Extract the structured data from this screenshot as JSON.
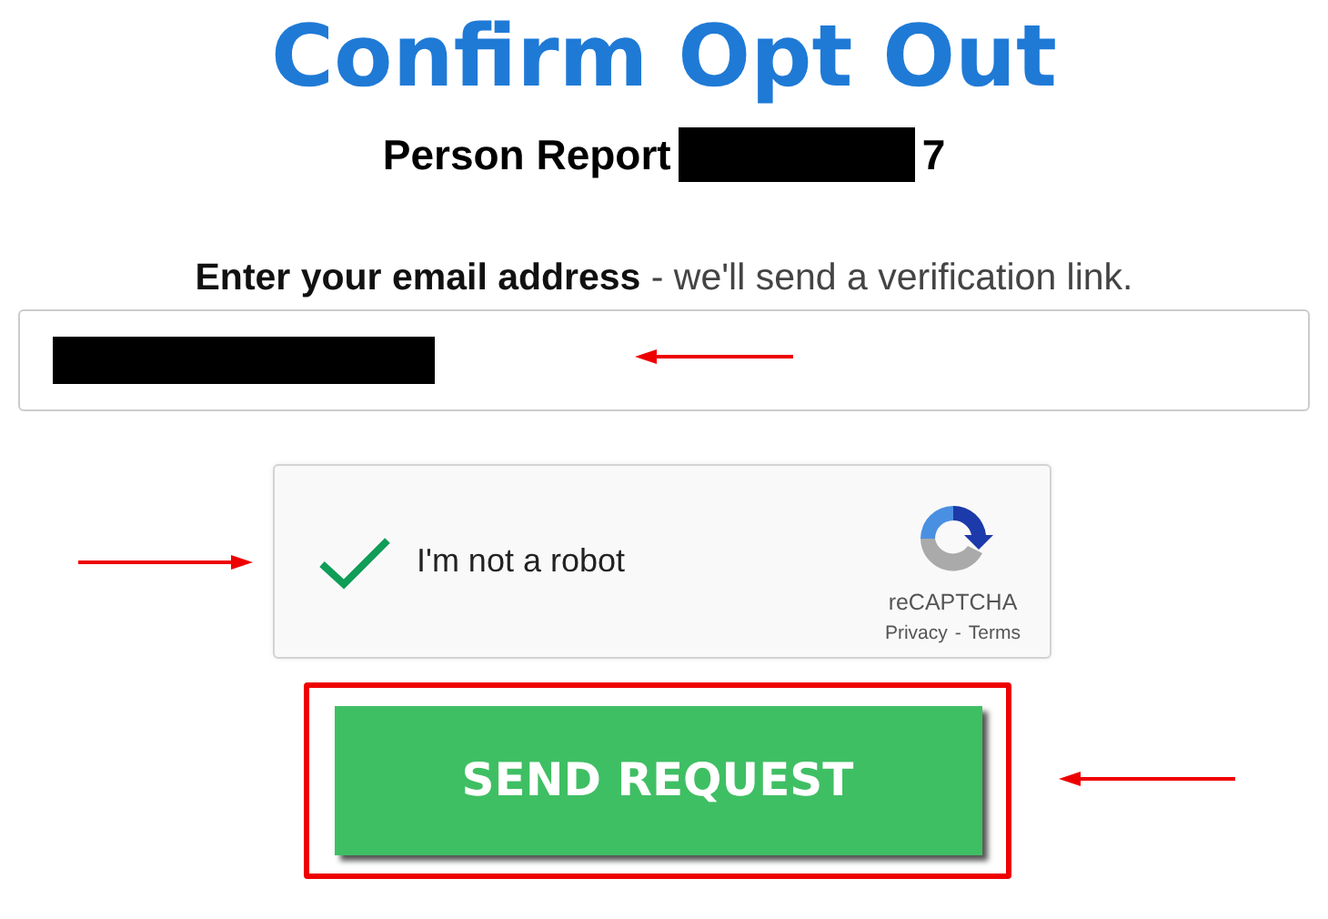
{
  "title": "Confirm Opt Out",
  "report": {
    "label": "Person Report",
    "suffix": "7"
  },
  "instruction": "**Enter your email address** - we'll send a verification link.",
  "captcha": {
    "checked": true,
    "label": "I'm not a robot",
    "brand": "reCAPTCHA",
    "privacy": "Privacy",
    "separator": "-",
    "terms": "Terms"
  },
  "submit": {
    "label": "SEND REQUEST"
  }
}
